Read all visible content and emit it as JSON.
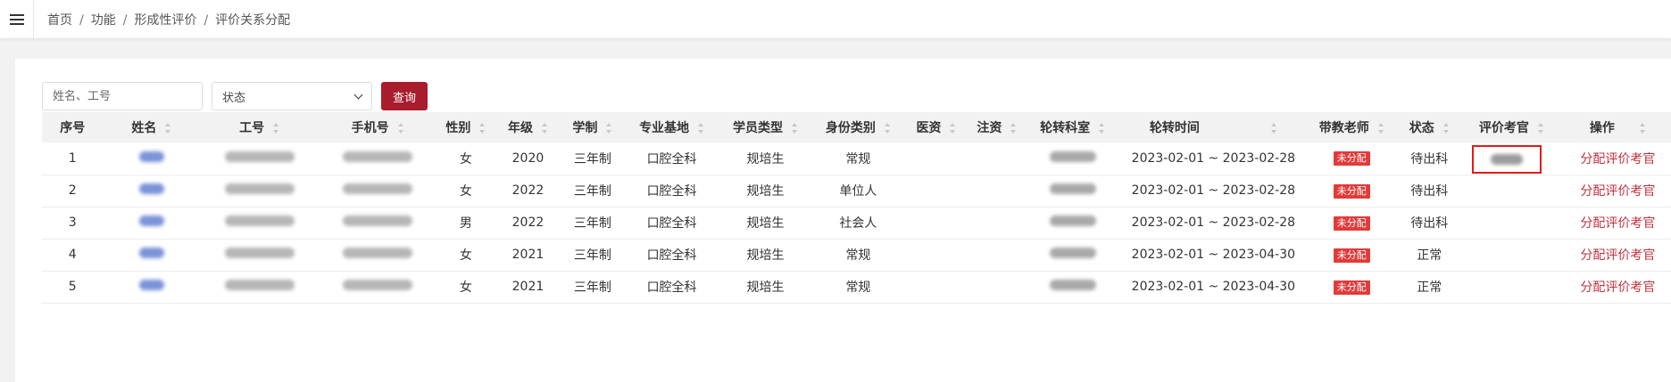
{
  "header": {
    "breadcrumb": [
      "首页",
      "功能",
      "形成性评价"
    ],
    "current": "评价关系分配",
    "separator": "/"
  },
  "search": {
    "name_placeholder": "姓名、工号",
    "status_placeholder": "状态",
    "query_label": "查询"
  },
  "table": {
    "columns": [
      "序号",
      "姓名",
      "工号",
      "手机号",
      "性别",
      "年级",
      "学制",
      "专业基地",
      "学员类型",
      "身份类别",
      "医资",
      "注资",
      "轮转科室",
      "轮转时间",
      "带教老师",
      "状态",
      "评价考官",
      "操作"
    ],
    "rows": [
      {
        "index": "1",
        "gender": "女",
        "grade": "2020",
        "system": "三年制",
        "base": "口腔全科",
        "type": "规培生",
        "identity": "常规",
        "time": "2023-02-01 ~ 2023-02-28",
        "teacher": "未分配",
        "status": "待出科",
        "action": "分配评价考官",
        "has_examiner": true
      },
      {
        "index": "2",
        "gender": "女",
        "grade": "2022",
        "system": "三年制",
        "base": "口腔全科",
        "type": "规培生",
        "identity": "单位人",
        "time": "2023-02-01 ~ 2023-02-28",
        "teacher": "未分配",
        "status": "待出科",
        "action": "分配评价考官",
        "has_examiner": false
      },
      {
        "index": "3",
        "gender": "男",
        "grade": "2022",
        "system": "三年制",
        "base": "口腔全科",
        "type": "规培生",
        "identity": "社会人",
        "time": "2023-02-01 ~ 2023-02-28",
        "teacher": "未分配",
        "status": "待出科",
        "action": "分配评价考官",
        "has_examiner": false
      },
      {
        "index": "4",
        "gender": "女",
        "grade": "2021",
        "system": "三年制",
        "base": "口腔全科",
        "type": "规培生",
        "identity": "常规",
        "time": "2023-02-01 ~ 2023-04-30",
        "teacher": "未分配",
        "status": "正常",
        "action": "分配评价考官",
        "has_examiner": false
      },
      {
        "index": "5",
        "gender": "女",
        "grade": "2021",
        "system": "三年制",
        "base": "口腔全科",
        "type": "规培生",
        "identity": "常规",
        "time": "2023-02-01 ~ 2023-04-30",
        "teacher": "未分配",
        "status": "正常",
        "action": "分配评价考官",
        "has_examiner": false
      }
    ]
  },
  "colors": {
    "accent": "#a81c2c",
    "badge": "#e23a3a",
    "link": "#c0303d",
    "highlight": "#e01b1b"
  }
}
